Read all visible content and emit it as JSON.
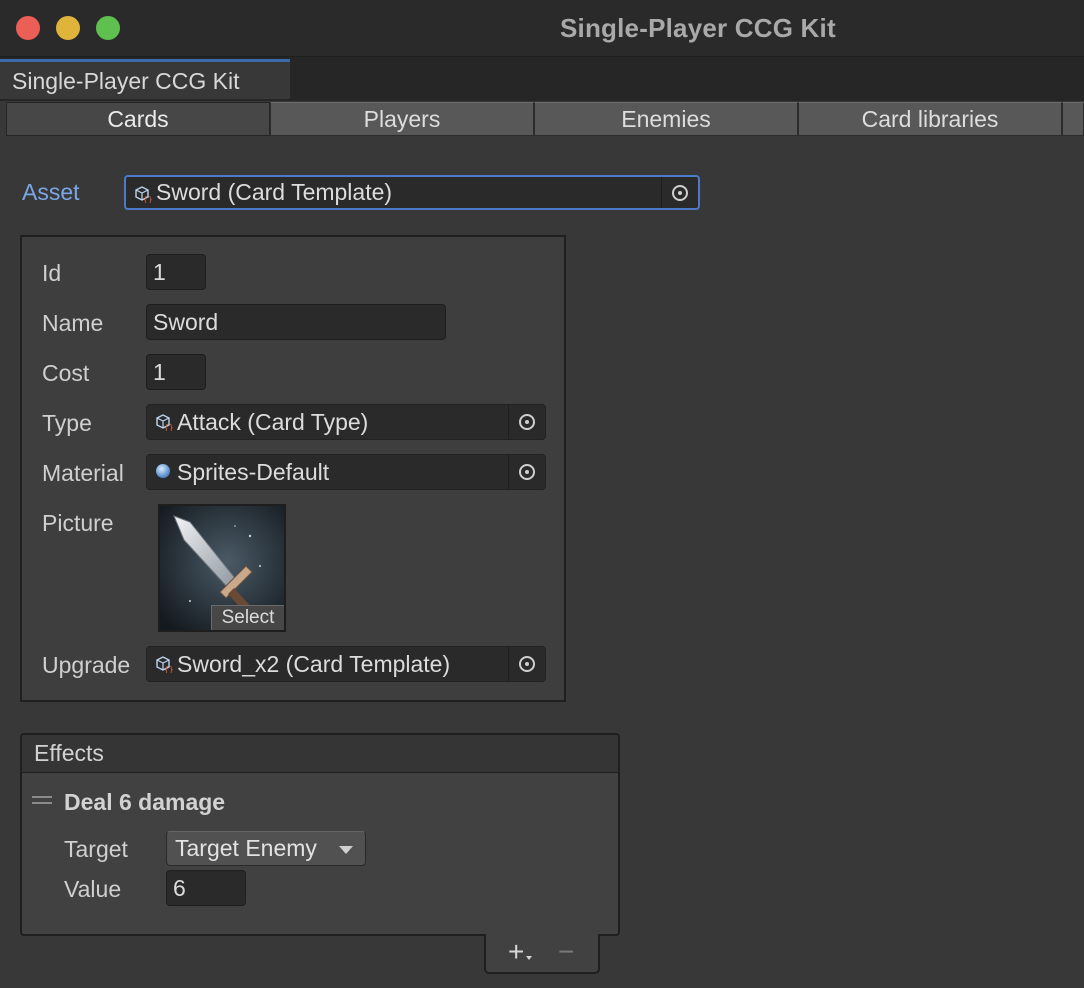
{
  "window": {
    "title": "Single-Player CCG Kit",
    "tab_label": "Single-Player CCG Kit"
  },
  "toolbar": {
    "tabs": [
      {
        "label": "Cards",
        "active": true
      },
      {
        "label": "Players",
        "active": false
      },
      {
        "label": "Enemies",
        "active": false
      },
      {
        "label": "Card libraries",
        "active": false
      }
    ]
  },
  "asset": {
    "label": "Asset",
    "value": "Sword (Card Template)",
    "icon": "scriptable-object-icon"
  },
  "properties": {
    "id": {
      "label": "Id",
      "value": "1"
    },
    "name": {
      "label": "Name",
      "value": "Sword"
    },
    "cost": {
      "label": "Cost",
      "value": "1"
    },
    "type": {
      "label": "Type",
      "value": "Attack (Card Type)",
      "icon": "scriptable-object-icon"
    },
    "material": {
      "label": "Material",
      "value": "Sprites-Default",
      "icon": "material-sphere-icon"
    },
    "picture": {
      "label": "Picture",
      "select_label": "Select",
      "icon": "sword-thumbnail"
    },
    "upgrade": {
      "label": "Upgrade",
      "value": "Sword_x2 (Card Template)",
      "icon": "scriptable-object-icon"
    }
  },
  "effects": {
    "header": "Effects",
    "items": [
      {
        "name": "Deal 6 damage",
        "target_label": "Target",
        "target_value": "Target Enemy",
        "value_label": "Value",
        "value": "6"
      }
    ],
    "add_label": "+",
    "remove_label": "−"
  },
  "colors": {
    "accent": "#4a7ac8",
    "asset_label": "#7aa6e6",
    "close": "#ec5f57",
    "minimize": "#e0b33a",
    "maximize": "#5fc04f"
  }
}
